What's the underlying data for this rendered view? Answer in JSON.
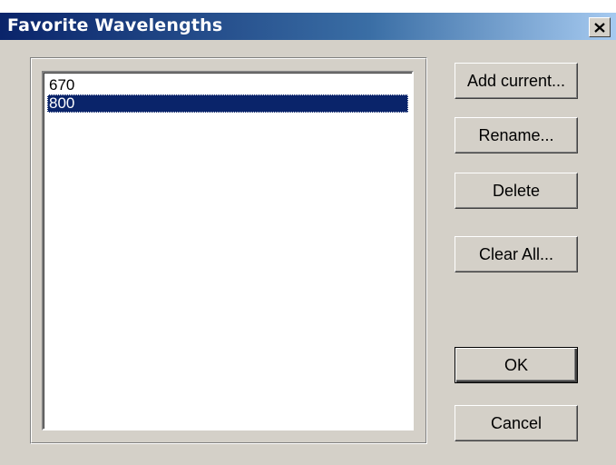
{
  "dialog": {
    "title": "Favorite Wavelengths",
    "close_glyph": "✕"
  },
  "list": {
    "items": [
      {
        "label": "670",
        "selected": false
      },
      {
        "label": "800",
        "selected": true
      }
    ]
  },
  "buttons": {
    "add_current": "Add current...",
    "rename": "Rename...",
    "delete": "Delete",
    "clear_all": "Clear All...",
    "ok": "OK",
    "cancel": "Cancel"
  },
  "colors": {
    "selection": "#0a246a",
    "face": "#d4d0c8"
  }
}
